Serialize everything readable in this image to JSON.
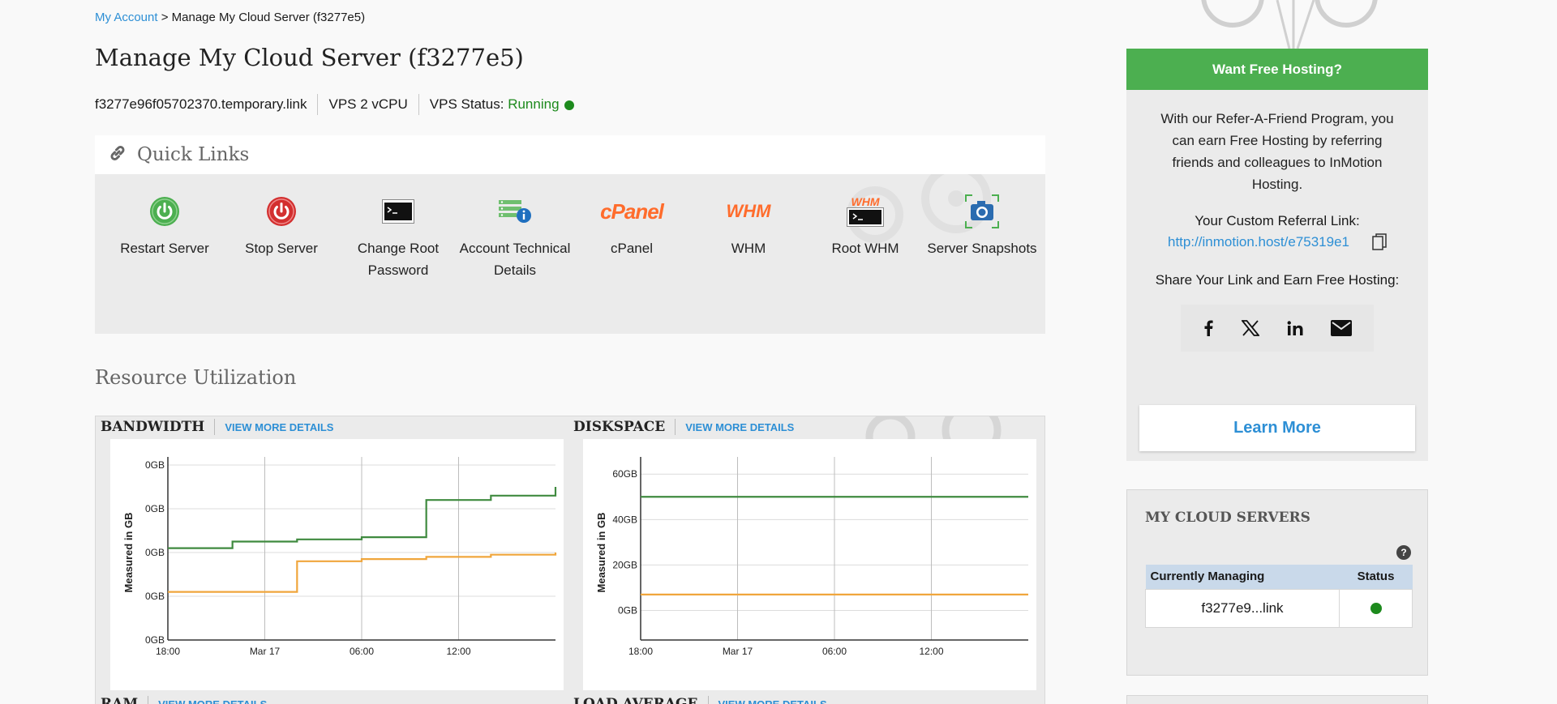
{
  "breadcrumb": {
    "home": "My Account",
    "separator": " > ",
    "current": "Manage My Cloud Server (f3277e5)"
  },
  "page_title": "Manage My Cloud Server (f3277e5)",
  "server_info": {
    "hostname": "f3277e96f05702370.temporary.link",
    "plan": "VPS 2 vCPU",
    "status_label": "VPS Status:",
    "status_value": "Running"
  },
  "quick_links": {
    "title": "Quick Links",
    "items": [
      {
        "label": "Restart Server",
        "icon": "power-icon"
      },
      {
        "label": "Stop Server",
        "icon": "stop-icon"
      },
      {
        "label": "Change Root Password",
        "icon": "terminal-icon"
      },
      {
        "label": "Account Technical Details",
        "icon": "server-info-icon"
      },
      {
        "label": "cPanel",
        "icon": "cpanel-logo"
      },
      {
        "label": "WHM",
        "icon": "whm-logo"
      },
      {
        "label": "Root WHM",
        "icon": "root-whm-icon"
      },
      {
        "label": "Server Snapshots",
        "icon": "camera-icon"
      }
    ],
    "logos": {
      "cpanel": "cPanel",
      "whm": "WHM"
    }
  },
  "resource_utilization": {
    "title": "Resource Utilization",
    "view_more": "VIEW MORE DETAILS",
    "row2_titles": [
      "RAM",
      "LOAD AVERAGE"
    ]
  },
  "chart_data": [
    {
      "type": "line",
      "title": "BANDWIDTH",
      "ylabel": "Measured in GB",
      "xticks": [
        "18:00",
        "Mar 17",
        "06:00",
        "12:00"
      ],
      "yticks": [
        "0GB",
        "0GB",
        "0GB",
        "0GB",
        "0GB"
      ],
      "ylim": [
        0,
        4
      ],
      "x": [
        0,
        4,
        8,
        12,
        16,
        20,
        24
      ],
      "series": [
        {
          "color": "#3f8a3f",
          "values": [
            2.1,
            2.25,
            2.3,
            2.35,
            3.2,
            3.3,
            3.5
          ]
        },
        {
          "color": "#f0a63c",
          "values": [
            1.1,
            1.1,
            1.8,
            1.85,
            1.9,
            1.95,
            2.0
          ]
        }
      ],
      "grid": true
    },
    {
      "type": "line",
      "title": "DISKSPACE",
      "ylabel": "Measured in GB",
      "xticks": [
        "18:00",
        "Mar 17",
        "06:00",
        "12:00"
      ],
      "yticks": [
        "0GB",
        "20GB",
        "40GB",
        "60GB"
      ],
      "ylim": [
        -13,
        64
      ],
      "x": [
        0,
        24
      ],
      "series": [
        {
          "color": "#3f8a3f",
          "values": [
            50,
            50
          ]
        },
        {
          "color": "#f0a63c",
          "values": [
            7,
            7
          ]
        }
      ],
      "grid": true
    }
  ],
  "promo": {
    "header": "Want Free Hosting?",
    "text": "With our Refer-A-Friend Program, you can earn Free Hosting by referring friends and colleagues to InMotion Hosting.",
    "ref_label": "Your Custom Referral Link:",
    "ref_link": "http://inmotion.host/e75319e1",
    "share_label": "Share Your Link and Earn Free Hosting:",
    "learn_more": "Learn More"
  },
  "my_servers": {
    "title": "MY CLOUD SERVERS",
    "help": "?",
    "columns": [
      "Currently Managing",
      "Status"
    ],
    "rows": [
      {
        "name": "f3277e9...link",
        "status": "running"
      }
    ]
  },
  "colors": {
    "accent_green": "#4caf50",
    "link_blue": "#2d8fd5",
    "running_green": "#1d8a1d"
  }
}
